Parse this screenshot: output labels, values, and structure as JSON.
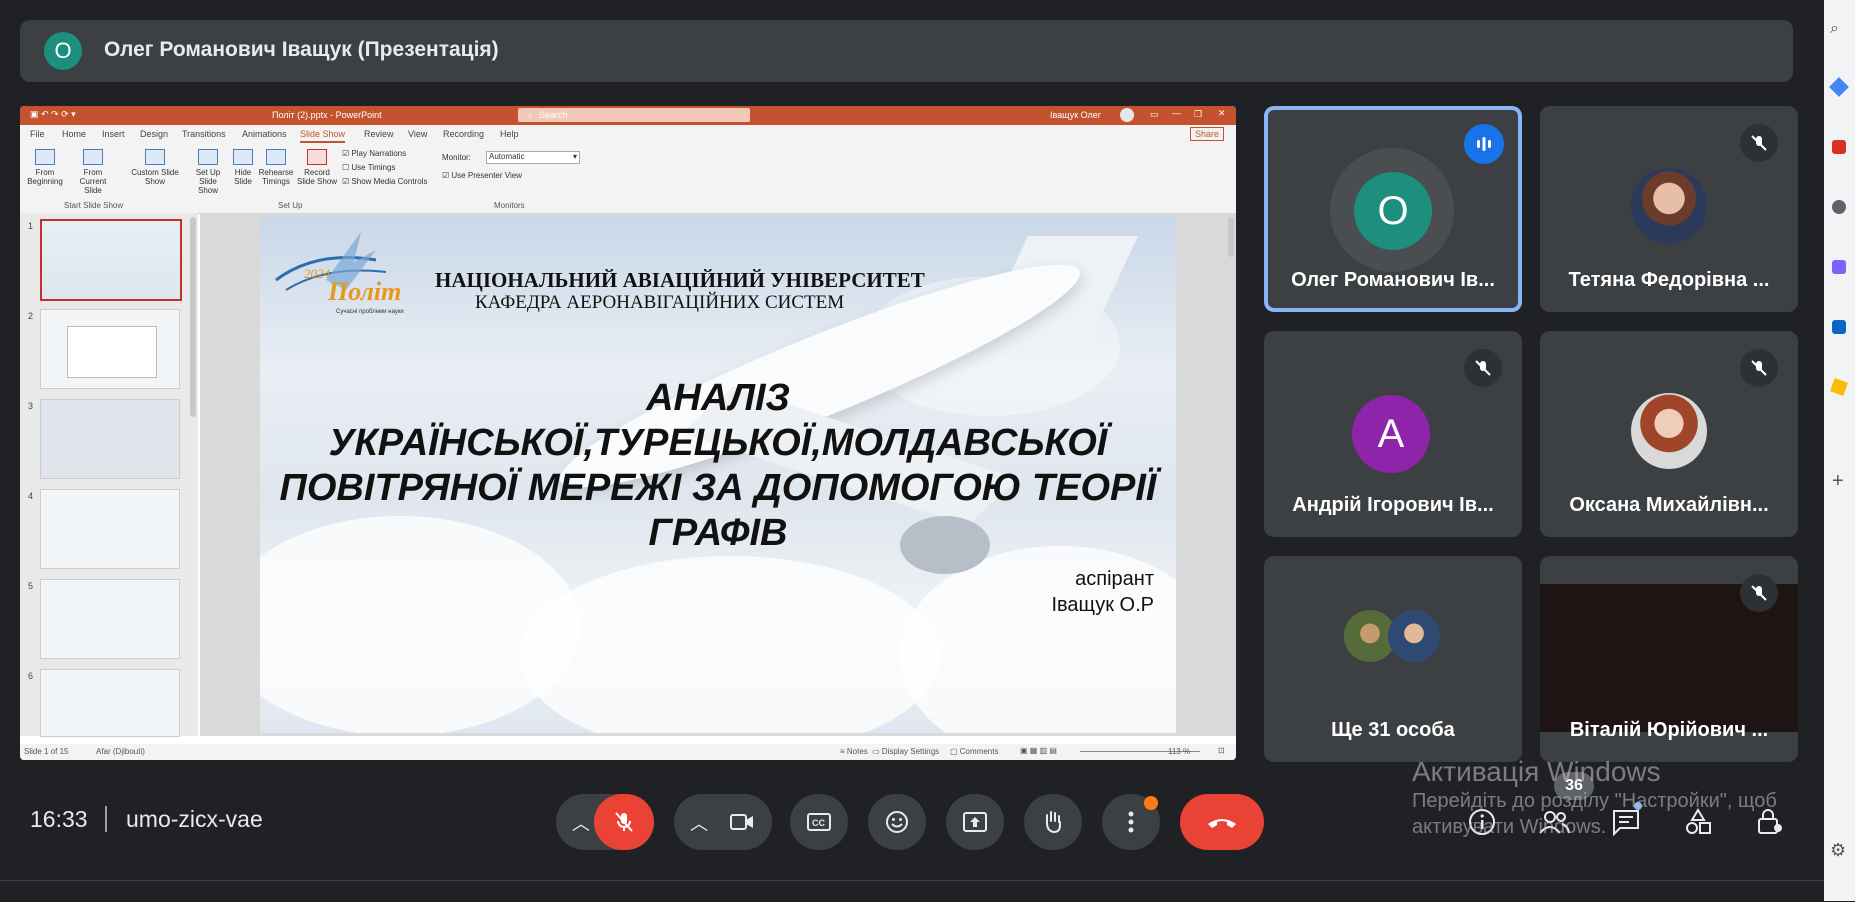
{
  "presenter_bar": {
    "avatar_letter": "О",
    "title": "Олег Романович Іващук (Презентація)"
  },
  "powerpoint": {
    "window_title": "Політ (2).pptx - PowerPoint",
    "search_placeholder": "Search",
    "user_name": "Іващук Олег",
    "share_label": "Share",
    "tabs": [
      "File",
      "Home",
      "Insert",
      "Design",
      "Transitions",
      "Animations",
      "Slide Show",
      "Review",
      "View",
      "Recording",
      "Help"
    ],
    "active_tab": "Slide Show",
    "ribbon": {
      "from_beginning": "From Beginning",
      "from_current": "From Current Slide",
      "custom_show": "Custom Slide Show",
      "group_start": "Start Slide Show",
      "setup_show": "Set Up Slide Show",
      "hide_slide": "Hide Slide",
      "rehearse": "Rehearse Timings",
      "record": "Record Slide Show",
      "play_narrations": "Play Narrations",
      "use_timings": "Use Timings",
      "show_media": "Show Media Controls",
      "group_setup": "Set Up",
      "monitor_label": "Monitor:",
      "monitor_value": "Automatic",
      "presenter_view": "Use Presenter View",
      "group_monitors": "Monitors"
    },
    "thumb_numbers": [
      "1",
      "2",
      "3",
      "4",
      "5",
      "6"
    ],
    "slide": {
      "university": "НАЦІОНАЛЬНИЙ АВІАЦІЙНИЙ УНІВЕРСИТЕТ",
      "department": "КАФЕДРА АЕРОНАВІГАЦІЙНИХ СИСТЕМ",
      "logo_text": "Політ",
      "logo_year": "2024",
      "logo_sub": "Сучасні проблеми науки",
      "title_line1": "АНАЛІЗ",
      "title_line2": "УКРАЇНСЬКОЇ,ТУРЕЦЬКОЇ,МОЛДАВСЬКОЇ",
      "title_line3": "ПОВІТРЯНОЇ МЕРЕЖІ ЗА ДОПОМОГОЮ ТЕОРІЇ",
      "title_line4": "ГРАФІВ",
      "author_role": "аспірант",
      "author_name": "Іващук О.Р"
    },
    "status": {
      "slide_info": "Slide 1 of 15",
      "language": "Afar (Djibouti)",
      "notes": "Notes",
      "display": "Display Settings",
      "comments": "Comments",
      "zoom": "113 %"
    }
  },
  "participants": [
    {
      "name": "Олег Романович Ів...",
      "avatar_letter": "О",
      "avatar_color": "#1e8e7e",
      "speaking": true
    },
    {
      "name": "Тетяна Федорівна ...",
      "muted": true
    },
    {
      "name": "Андрій Ігорович Ів...",
      "avatar_letter": "А",
      "avatar_color": "#8e24aa",
      "muted": true
    },
    {
      "name": "Оксана Михайлівн...",
      "muted": true
    },
    {
      "name": "Ще 31 особа"
    },
    {
      "name": "Віталій Юрійович ...",
      "muted": true
    }
  ],
  "bottom_bar": {
    "time": "16:33",
    "meeting_code": "umo-zicx-vae",
    "people_count": "36"
  },
  "watermark": {
    "title": "Активація Windows",
    "line1": "Перейдіть до розділу \"Настройки\", щоб",
    "line2": "активувати Windows."
  },
  "colors": {
    "accent": "#8ab4f8",
    "hangup": "#ea4335",
    "mic_off": "#ea4335",
    "powerpoint": "#c4522f"
  }
}
